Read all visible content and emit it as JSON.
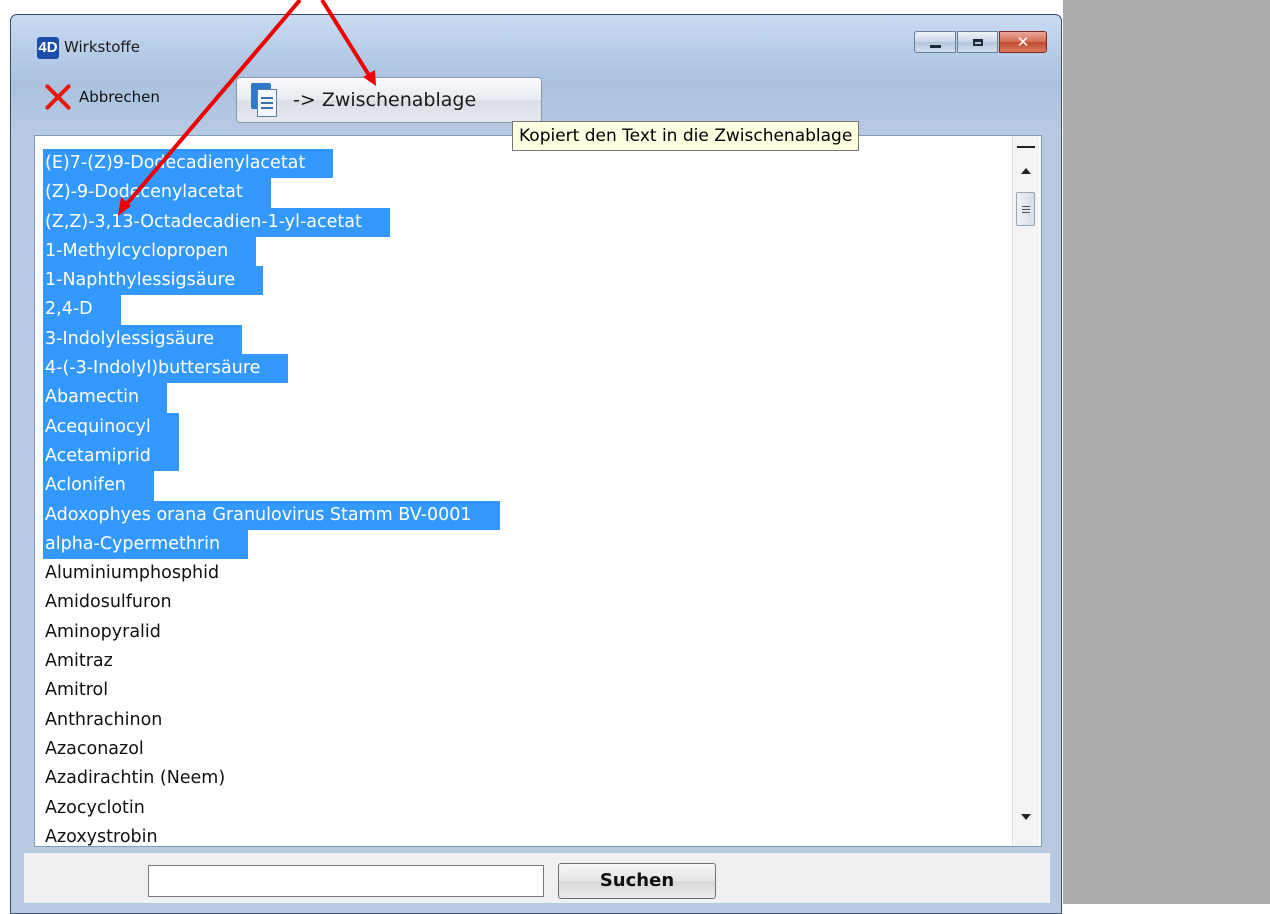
{
  "window": {
    "logo": "4D",
    "title": "Wirkstoffe"
  },
  "toolbar": {
    "cancel_label": "Abbrechen",
    "clipboard_label": "-> Zwischenablage",
    "tooltip": "Kopiert den Text in die Zwischenablage"
  },
  "list": {
    "items": [
      {
        "label": "(E)7-(Z)9-Dodecadienylacetat",
        "selected": true
      },
      {
        "label": "(Z)-9-Dodecenylacetat",
        "selected": true
      },
      {
        "label": "(Z,Z)-3,13-Octadecadien-1-yl-acetat",
        "selected": true
      },
      {
        "label": "1-Methylcyclopropen",
        "selected": true
      },
      {
        "label": "1-Naphthylessigsäure",
        "selected": true
      },
      {
        "label": "2,4-D",
        "selected": true
      },
      {
        "label": "3-Indolylessigsäure",
        "selected": true
      },
      {
        "label": "4-(-3-Indolyl)buttersäure",
        "selected": true
      },
      {
        "label": "Abamectin",
        "selected": true
      },
      {
        "label": "Acequinocyl",
        "selected": true
      },
      {
        "label": "Acetamiprid",
        "selected": true
      },
      {
        "label": "Aclonifen",
        "selected": true
      },
      {
        "label": "Adoxophyes orana Granulovirus Stamm BV-0001",
        "selected": true
      },
      {
        "label": "alpha-Cypermethrin",
        "selected": true
      },
      {
        "label": "Aluminiumphosphid",
        "selected": false
      },
      {
        "label": "Amidosulfuron",
        "selected": false
      },
      {
        "label": "Aminopyralid",
        "selected": false
      },
      {
        "label": "Amitraz",
        "selected": false
      },
      {
        "label": "Amitrol",
        "selected": false
      },
      {
        "label": "Anthrachinon",
        "selected": false
      },
      {
        "label": "Azaconazol",
        "selected": false
      },
      {
        "label": "Azadirachtin (Neem)",
        "selected": false
      },
      {
        "label": "Azocyclotin",
        "selected": false
      },
      {
        "label": "Azoxystrobin",
        "selected": false
      }
    ]
  },
  "search": {
    "value": "",
    "button_label": "Suchen"
  },
  "colors": {
    "selection": "#3399ff",
    "arrow": "#ee0000",
    "desktop": "#ababab"
  }
}
